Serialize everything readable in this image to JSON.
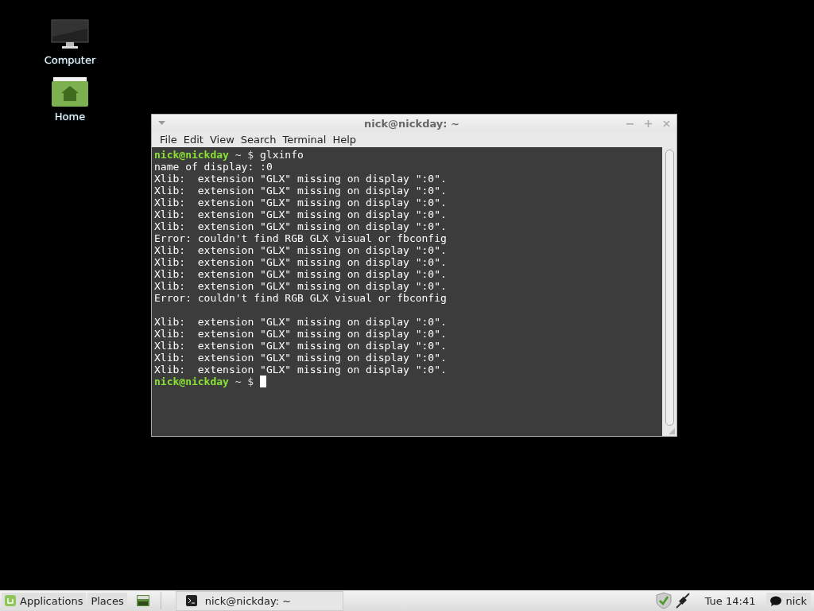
{
  "desktop_icons": [
    {
      "kind": "computer",
      "label": "Computer"
    },
    {
      "kind": "home",
      "label": "Home"
    }
  ],
  "window": {
    "title": "nick@nickday: ~",
    "menu": [
      "File",
      "Edit",
      "View",
      "Search",
      "Terminal",
      "Help"
    ],
    "lines": [
      {
        "kind": "prompt",
        "user": "nick@nickday",
        "path": "~ $",
        "command": "glxinfo"
      },
      {
        "kind": "output",
        "text": "name of display: :0"
      },
      {
        "kind": "output",
        "text": "Xlib:  extension \"GLX\" missing on display \":0\"."
      },
      {
        "kind": "output",
        "text": "Xlib:  extension \"GLX\" missing on display \":0\"."
      },
      {
        "kind": "output",
        "text": "Xlib:  extension \"GLX\" missing on display \":0\"."
      },
      {
        "kind": "output",
        "text": "Xlib:  extension \"GLX\" missing on display \":0\"."
      },
      {
        "kind": "output",
        "text": "Xlib:  extension \"GLX\" missing on display \":0\"."
      },
      {
        "kind": "output",
        "text": "Error: couldn't find RGB GLX visual or fbconfig"
      },
      {
        "kind": "output",
        "text": "Xlib:  extension \"GLX\" missing on display \":0\"."
      },
      {
        "kind": "output",
        "text": "Xlib:  extension \"GLX\" missing on display \":0\"."
      },
      {
        "kind": "output",
        "text": "Xlib:  extension \"GLX\" missing on display \":0\"."
      },
      {
        "kind": "output",
        "text": "Xlib:  extension \"GLX\" missing on display \":0\"."
      },
      {
        "kind": "output",
        "text": "Error: couldn't find RGB GLX visual or fbconfig"
      },
      {
        "kind": "blank"
      },
      {
        "kind": "output",
        "text": "Xlib:  extension \"GLX\" missing on display \":0\"."
      },
      {
        "kind": "output",
        "text": "Xlib:  extension \"GLX\" missing on display \":0\"."
      },
      {
        "kind": "output",
        "text": "Xlib:  extension \"GLX\" missing on display \":0\"."
      },
      {
        "kind": "output",
        "text": "Xlib:  extension \"GLX\" missing on display \":0\"."
      },
      {
        "kind": "output",
        "text": "Xlib:  extension \"GLX\" missing on display \":0\"."
      },
      {
        "kind": "prompt",
        "user": "nick@nickday",
        "path": "~ $",
        "cursor": true
      }
    ]
  },
  "panel": {
    "menu": "Applications",
    "places": "Places",
    "window_button": "nick@nickday: ~",
    "clock": "Tue 14:41",
    "user": "nick"
  }
}
